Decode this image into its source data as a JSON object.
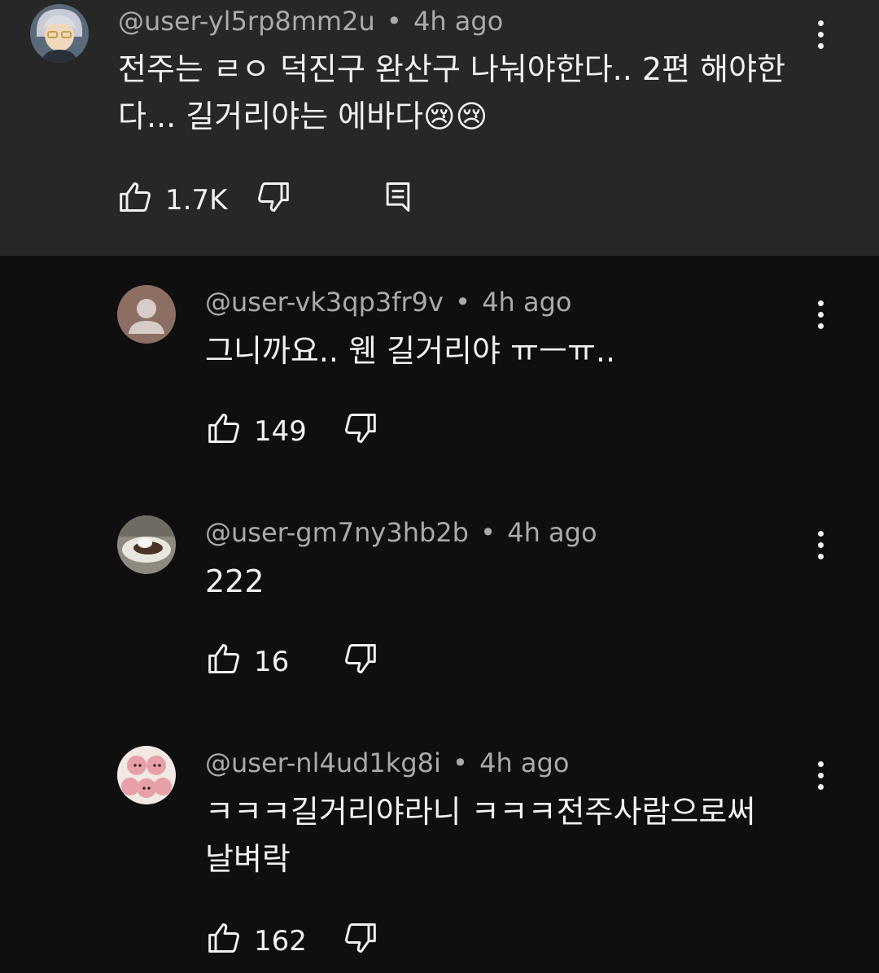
{
  "comments": [
    {
      "author": "@user-yl5rp8mm2u",
      "separator": "•",
      "time": "4h ago",
      "text_line1": "전주는 ㄹㅇ 덕진구 완산구 나눠야한다.. 2편 해야한",
      "text_line2": "다... 길거리야는 에바다😢😢",
      "likes": "1.7K",
      "avatar_icon": "anime-character-avatar"
    },
    {
      "author": "@user-vk3qp3fr9v",
      "separator": "•",
      "time": "4h ago",
      "text_line1": "그니까요.. 웬 길거리야 ㅠㅡㅠ..",
      "likes": "149",
      "avatar_icon": "default-person-avatar"
    },
    {
      "author": "@user-gm7ny3hb2b",
      "separator": "•",
      "time": "4h ago",
      "text_line1": "222",
      "likes": "16",
      "avatar_icon": "food-plate-photo-avatar"
    },
    {
      "author": "@user-nl4ud1kg8i",
      "separator": "•",
      "time": "4h ago",
      "text_line1": "ㅋㅋㅋ길거리야라니 ㅋㅋㅋ전주사람으로써",
      "text_line2": "날벼락",
      "likes": "162",
      "avatar_icon": "pink-characters-avatar"
    }
  ],
  "colors": {
    "background": "#0f0f0f",
    "parent_background": "#272727",
    "meta_text": "#aaaaaa",
    "primary_text": "#f1f1f1"
  }
}
